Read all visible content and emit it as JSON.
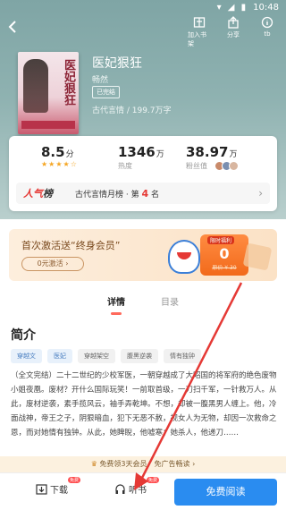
{
  "status_bar": {
    "icons": "▾ ◢ ▮",
    "time": "10:48"
  },
  "top_actions": [
    {
      "label": "加入书架",
      "icon": "bookshelf-icon"
    },
    {
      "label": "分享",
      "icon": "share-icon"
    },
    {
      "label": "tb",
      "icon": "info-icon"
    }
  ],
  "book": {
    "cover_title": "医妃狠狂",
    "title": "医妃狠狂",
    "author": "畅然",
    "status": "已完结",
    "meta": "古代言情 / 199.7万字"
  },
  "stats": {
    "rating": {
      "value": "8.5",
      "unit": "分",
      "stars": "★★★★☆"
    },
    "heat": {
      "value": "1346",
      "unit": "万",
      "label": "热度"
    },
    "fans": {
      "value": "38.97",
      "unit": "万",
      "label": "粉丝值"
    }
  },
  "rank": {
    "logo_a": "人气",
    "logo_b": "榜",
    "text_prefix": "古代言情月榜 · 第",
    "rank_number": "4",
    "text_suffix": "名"
  },
  "vip": {
    "title": "首次激活送“终身会员”",
    "button": "0元激活 ›",
    "coupon_label": "限时福利",
    "coupon_price": "0",
    "coupon_original": "原价 ¥ 30"
  },
  "tabs": [
    "详情",
    "目录"
  ],
  "section_title": "简介",
  "tags": [
    "穿越文",
    "医妃",
    "穿越架空",
    "腹黑逆袭",
    "情有独钟"
  ],
  "synopsis": "（全文完结）二十二世纪的少校军医，一朝穿越成了大昭国的将军府的绝色废物小姐夜凰。废材？开什么国际玩笑！一前取首级，一刀扫千军，一针救万人。从此，废材逆袭，素手揽风云，袖手弄乾坤。不想，却被一腹黑男人缠上。他，冷面战神，帝王之子，阴狠暗血，犯下无恶不赦，视女人为无物，却因一次救命之恩，而对她情有独钟。从此，她睥睨，他嘘寒；她杀人，他递刀……",
  "ad_hint": "免费领3天会员，免广告畅读 ›",
  "bottom_bar": {
    "download": "下载",
    "download_badge": "免费",
    "listen": "听书",
    "listen_badge": "免费",
    "read": "免费阅读"
  },
  "colors": {
    "accent": "#2a8cf0",
    "header": "#8fb2b1",
    "rank_red": "#e53935",
    "arrow": "#e53935"
  }
}
